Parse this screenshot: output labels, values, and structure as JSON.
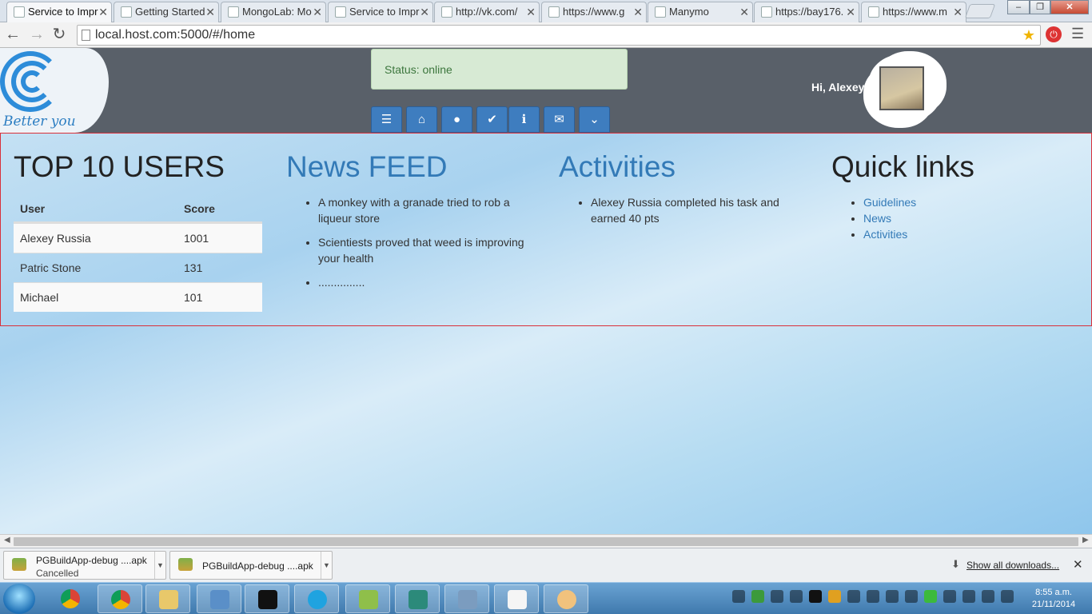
{
  "browser": {
    "tabs": [
      {
        "title": "Service to Impr",
        "active": true
      },
      {
        "title": "Getting Started"
      },
      {
        "title": "MongoLab: Mo"
      },
      {
        "title": "Service to Impr"
      },
      {
        "title": "http://vk.com/"
      },
      {
        "title": "https://www.g"
      },
      {
        "title": "Manymo"
      },
      {
        "title": "https://bay176."
      },
      {
        "title": "https://www.m"
      }
    ],
    "address": "local.host.com:5000/#/home",
    "window_controls": {
      "minimize": "–",
      "maximize": "❐",
      "close": "✕"
    }
  },
  "header": {
    "logo_tagline": "Better you",
    "status": "Status: online",
    "greeting": "Hi, Alexey",
    "nav_icons": [
      "list-icon",
      "home-icon",
      "user-icon",
      "check-icon",
      "info-icon",
      "mail-icon",
      "chevron-down-icon"
    ],
    "nav_glyphs": [
      "☰",
      "⌂",
      "●",
      "✔",
      "ℹ",
      "✉",
      "⌄"
    ]
  },
  "top_users": {
    "title": "TOP 10 USERS",
    "columns": [
      "User",
      "Score"
    ],
    "rows": [
      {
        "name": "Alexey Russia",
        "score": "1001"
      },
      {
        "name": "Patric Stone",
        "score": "131"
      },
      {
        "name": "Michael",
        "score": "101"
      }
    ]
  },
  "news": {
    "title": "News FEED",
    "items": [
      "A monkey with a granade tried to rob a liqueur store",
      "Scientiests proved that weed is improving your health",
      "..............."
    ]
  },
  "activities": {
    "title": "Activities",
    "items": [
      "Alexey Russia completed his task and earned 40 pts"
    ]
  },
  "quick_links": {
    "title": "Quick links",
    "items": [
      "Guidelines",
      "News",
      "Activities"
    ]
  },
  "downloads": {
    "items": [
      {
        "name": "PGBuildApp-debug ....apk",
        "status": "Cancelled"
      },
      {
        "name": "PGBuildApp-debug ....apk",
        "status": ""
      }
    ],
    "show_all": "Show all downloads...",
    "close": "✕"
  },
  "taskbar": {
    "time": "8:55 a.m.",
    "date": "21/11/2014"
  }
}
